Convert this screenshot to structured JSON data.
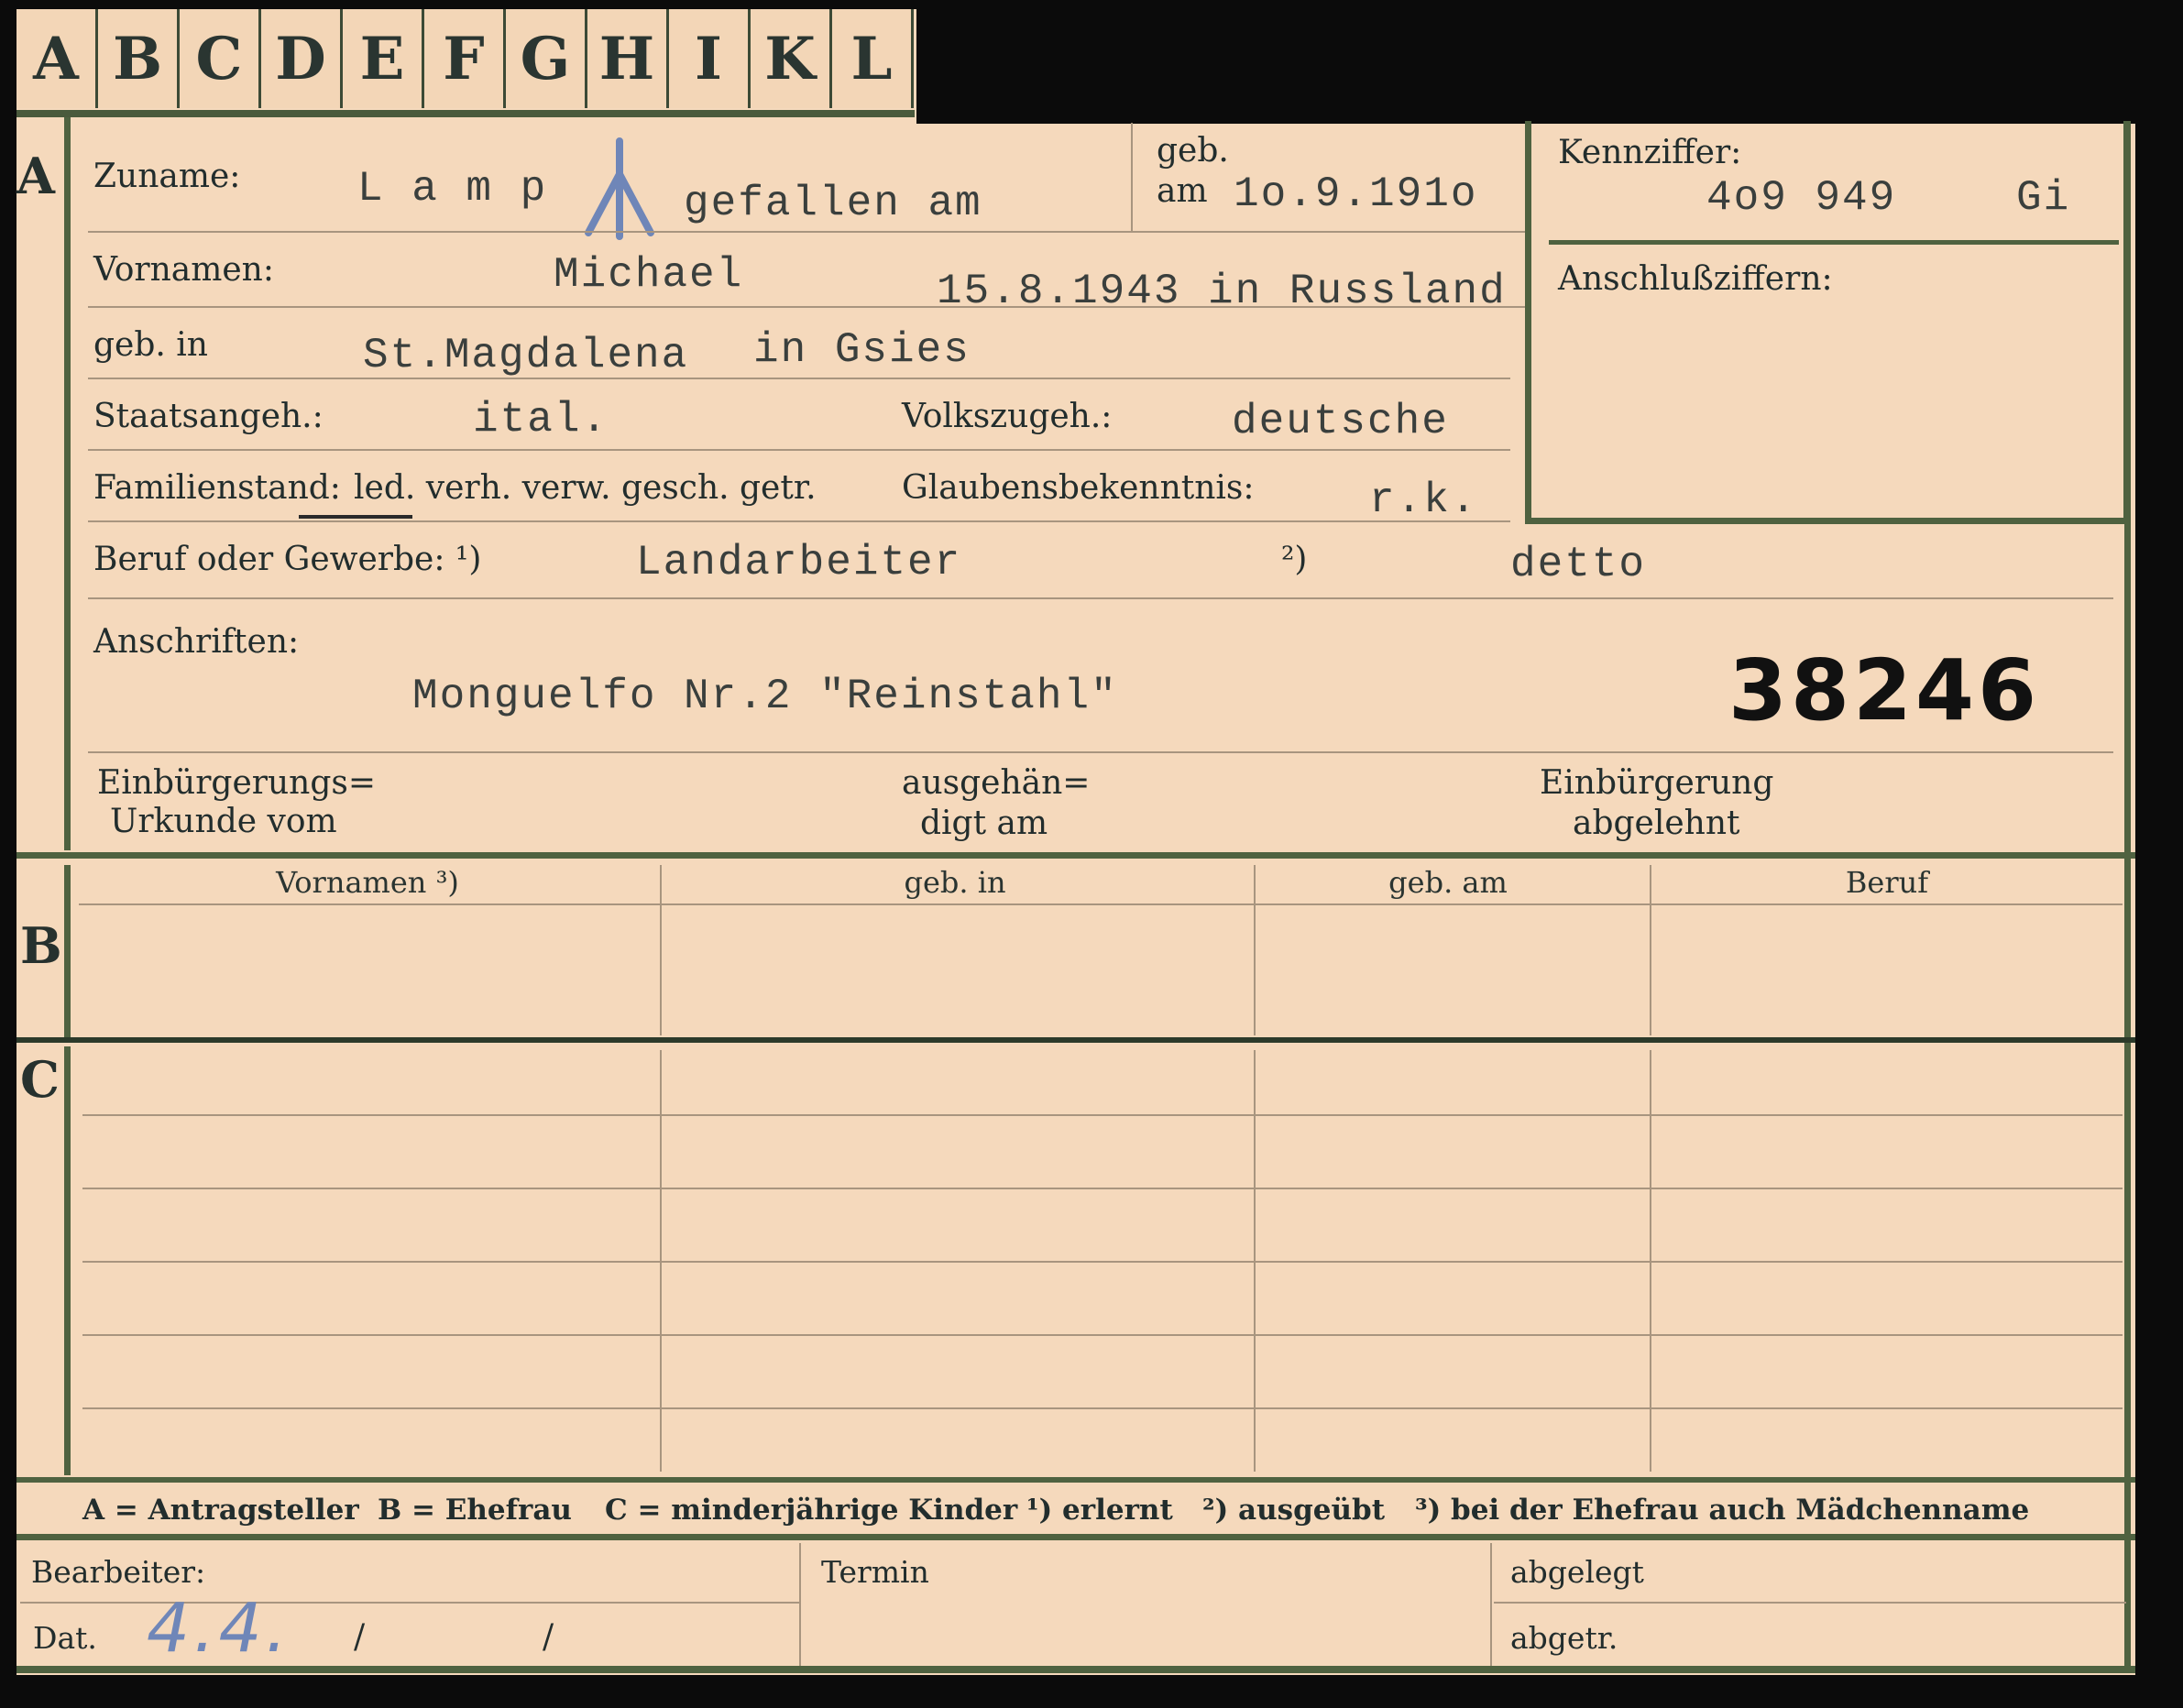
{
  "tabs": [
    "A",
    "B",
    "C",
    "D",
    "E",
    "F",
    "G",
    "H",
    "I",
    "K",
    "L"
  ],
  "sections": {
    "a": "A",
    "b": "B",
    "c": "C"
  },
  "labels": {
    "zuname": "Zuname:",
    "geb_am_top": "geb.",
    "geb_am_bottom": "am",
    "kennziffer": "Kennziffer:",
    "anschlussziffern": "Anschlußziffern:",
    "vornamen": "Vornamen:",
    "geb_in": "geb. in",
    "staatsangeh": "Staatsangeh.:",
    "volkszugeh": "Volkszugeh.:",
    "familienstand": "Familienstand:",
    "familienstand_options": "led. verh. verw. gesch. getr.",
    "glaubensbekenntnis": "Glaubensbekenntnis:",
    "beruf": "Beruf oder Gewerbe: ¹)",
    "beruf_2": "²)",
    "anschriften": "Anschriften:",
    "einbuergerungs_1": "Einbürgerungs=",
    "einbuergerungs_2": "Urkunde vom",
    "ausgehaen_1": "ausgehän=",
    "ausgehaen_2": "digt am",
    "einbuergerung_1": "Einbürgerung",
    "einbuergerung_2": "abgelehnt",
    "bearbeiter": "Bearbeiter:",
    "dat": "Dat.",
    "dat_slash_1": "/",
    "dat_slash_2": "/",
    "termin": "Termin",
    "abgelegt": "abgelegt",
    "abgetr": "abgetr."
  },
  "values": {
    "zuname": "L a m p",
    "gefallen": "gefallen am",
    "geb_am": "1o.9.191o",
    "kennziffer": "4o9 949",
    "kennziffer_suffix": "Gi",
    "vornamen": "Michael",
    "gefallen_detail": "15.8.1943 in Russland",
    "geb_in": "St.Magdalena",
    "geb_in_2": "in Gsies",
    "staatsangeh": "ital.",
    "volkszugeh": "deutsche",
    "glaubensbekenntnis": "r.k.",
    "beruf_1": "Landarbeiter",
    "beruf_2": "detto",
    "anschrift": "Monguelfo  Nr.2 \"Reinstahl\"",
    "stamp_number": "38246",
    "dat_handwritten": "4.4."
  },
  "table_headers": [
    "Vornamen ³)",
    "geb. in",
    "geb. am",
    "Beruf"
  ],
  "footnote": {
    "a": "A = Antragsteller",
    "b": "B = Ehefrau",
    "c": "C = minderjährige Kinder",
    "n1": "¹) erlernt",
    "n2": "²) ausgeübt",
    "n3": "³) bei der Ehefrau auch Mädchenname"
  },
  "colors": {
    "card": "#f5d9bc",
    "border": "#4f6240",
    "ink": "#3a3f3d",
    "stamp": "#111111",
    "pen": "#6f86b8"
  }
}
